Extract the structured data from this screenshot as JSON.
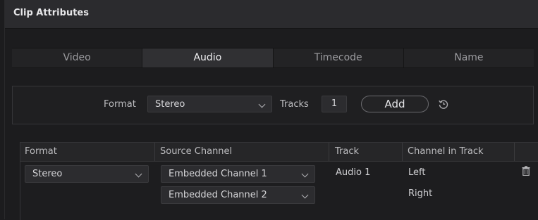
{
  "window": {
    "title": "Clip Attributes"
  },
  "tabs": [
    {
      "label": "Video",
      "active": false
    },
    {
      "label": "Audio",
      "active": true
    },
    {
      "label": "Timecode",
      "active": false
    },
    {
      "label": "Name",
      "active": false
    }
  ],
  "format_panel": {
    "format_label": "Format",
    "format_value": "Stereo",
    "tracks_label": "Tracks",
    "tracks_value": "1",
    "add_label": "Add",
    "reset_icon": "reset-icon"
  },
  "table": {
    "headers": [
      "Format",
      "Source Channel",
      "Track",
      "Channel in Track"
    ],
    "rows": [
      {
        "format": "Stereo",
        "source_channel": "Embedded Channel 1",
        "track": "Audio 1",
        "channel_in_track": "Left"
      },
      {
        "source_channel": "Embedded Channel 2",
        "channel_in_track": "Right"
      }
    ],
    "delete_icon": "trash-icon"
  },
  "colors": {
    "background": "#1c1c1e",
    "active_tab": "#303033",
    "text": "#c9c9cb"
  }
}
